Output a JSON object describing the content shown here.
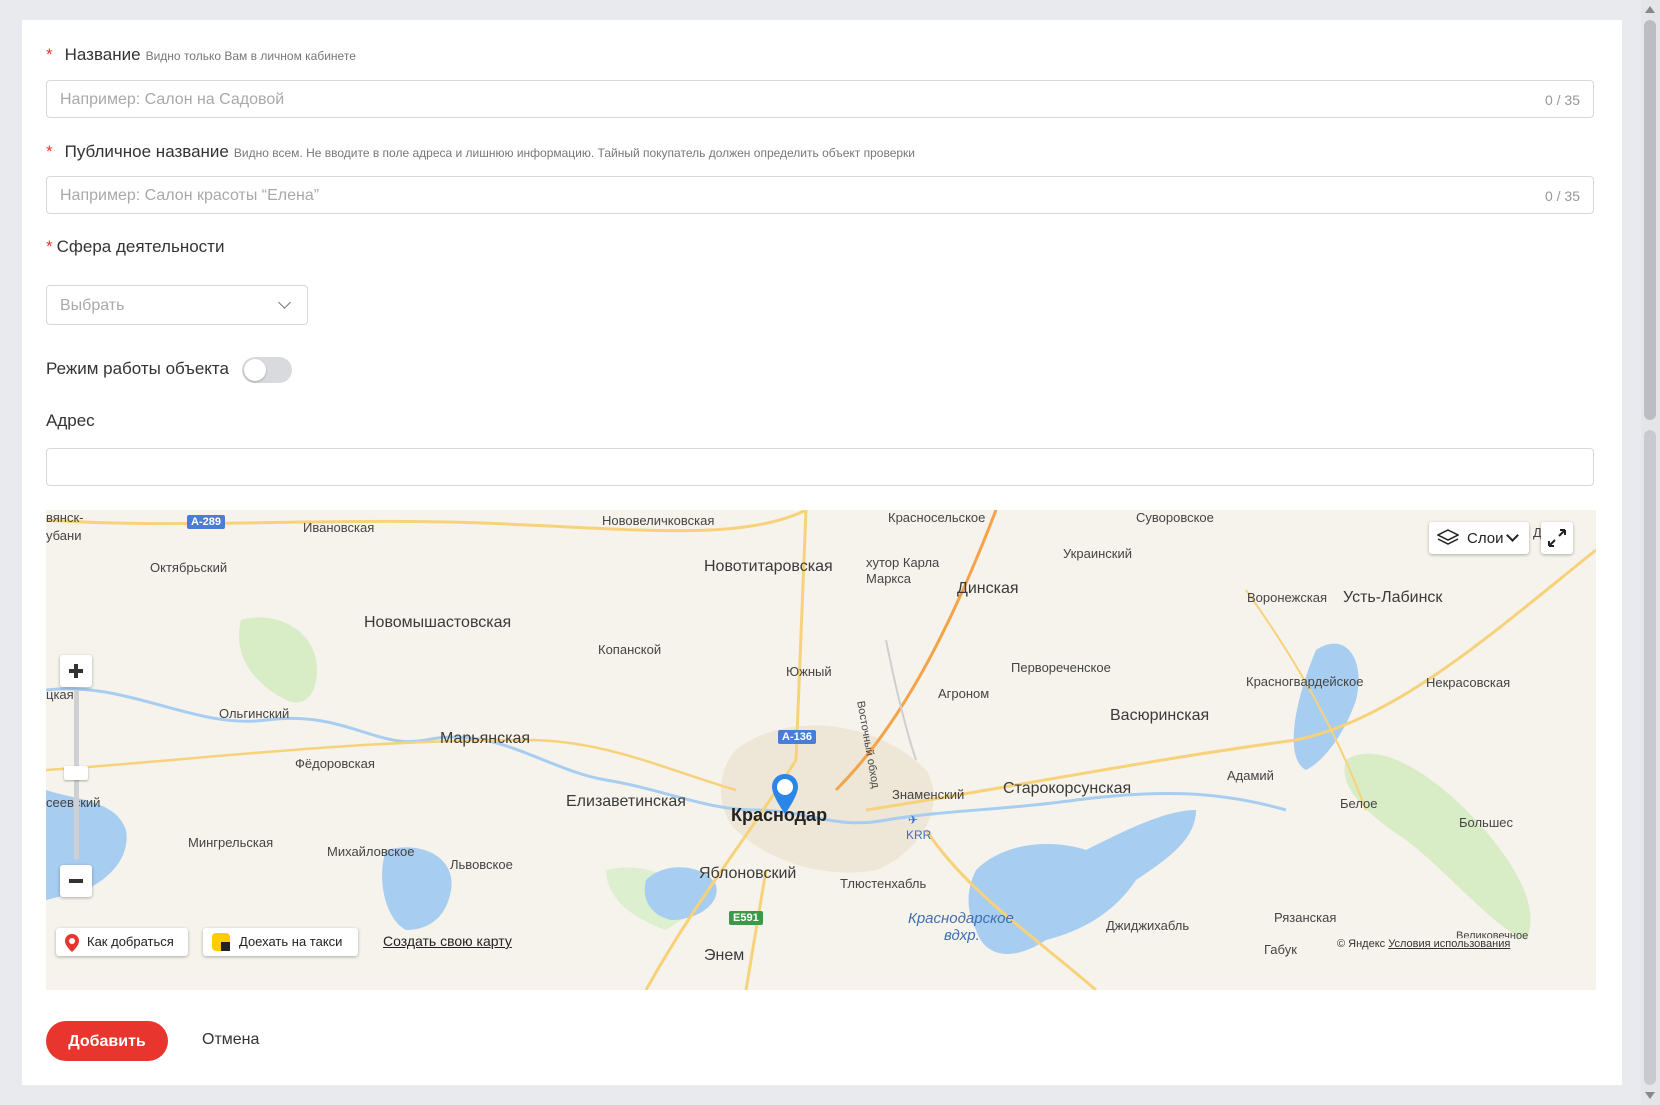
{
  "form": {
    "name": {
      "label": "Название",
      "hint": "Видно только Вам в личном кабинете",
      "placeholder": "Например: Салон на Садовой",
      "counter": "0 / 35",
      "required_mark": "*"
    },
    "public_name": {
      "label": "Публичное название",
      "hint": "Видно всем. Не вводите в поле адреса и лишнюю информацию. Тайный покупатель должен определить объект проверки",
      "placeholder": "Например: Салон красоты “Елена”",
      "counter": "0 / 35",
      "required_mark": "*"
    },
    "activity": {
      "label": "Сфера деятельности",
      "placeholder": "Выбрать",
      "required_mark": "*"
    },
    "schedule": {
      "label": "Режим работы объекта",
      "enabled": false
    },
    "address": {
      "label": "Адрес",
      "value": ""
    }
  },
  "map": {
    "labels": {
      "l1": "Новотитаровская",
      "l2": "Новомышастовская",
      "l3": "Марьянская",
      "l4": "Елизаветинская",
      "l5": "Краснодар",
      "l6": "Яблоновский",
      "l7": "Динская",
      "l8": "Васюринская",
      "l9": "Старокорсунская",
      "l10": "Усть-Лабинск",
      "l11": "Октябрьский",
      "l12": "Ивановская",
      "l13": "Нововеличковская",
      "l14": "Красносельское",
      "l15": "Суворовское",
      "l16": "Украинский",
      "l17": "хутор Карла",
      "l18": "Маркса",
      "l19": "Копанской",
      "l20": "Южный",
      "l21": "Агроном",
      "l22": "Первореченское",
      "l23": "Воронежская",
      "l24": "Красногвардейское",
      "l25": "Некрасовская",
      "l26": "Ольгинский",
      "l27": "Фёдоровская",
      "l28": "Мингрельская",
      "l29": "Михайловское",
      "l30": "Львовское",
      "l31": "Знаменский",
      "l32": "Тлюстенхабль",
      "l33": "Адамий",
      "l34": "Белое",
      "l35": "Большес",
      "l36": "Рязанская",
      "l37": "Джиджихабль",
      "l38": "Энем",
      "l39": "Габук",
      "l40": "Восточный обход",
      "l41": "KRR",
      "l42": "цкая",
      "l43": "сеевский",
      "l44": "вянск-",
      "l45": "убани",
      "l46": "Краснодарское",
      "l47": "вдхр.",
      "l48": "Ду",
      "l49": "Великовечное"
    },
    "road_badges": {
      "a289": "А-289",
      "a136": "А-136",
      "e591": "E591"
    },
    "layers_label": "Слои",
    "route_label": "Как добраться",
    "taxi_label": "Доехать на такси",
    "create_map_label": "Создать свою карту",
    "copyright": "© Яндекс",
    "terms": "Условия использования"
  },
  "actions": {
    "submit": "Добавить",
    "cancel": "Отмена"
  },
  "colors": {
    "accent": "#e8352e",
    "map_water": "#a7cdf0",
    "map_road": "#f7d27a",
    "pin": "#2b86e8"
  }
}
